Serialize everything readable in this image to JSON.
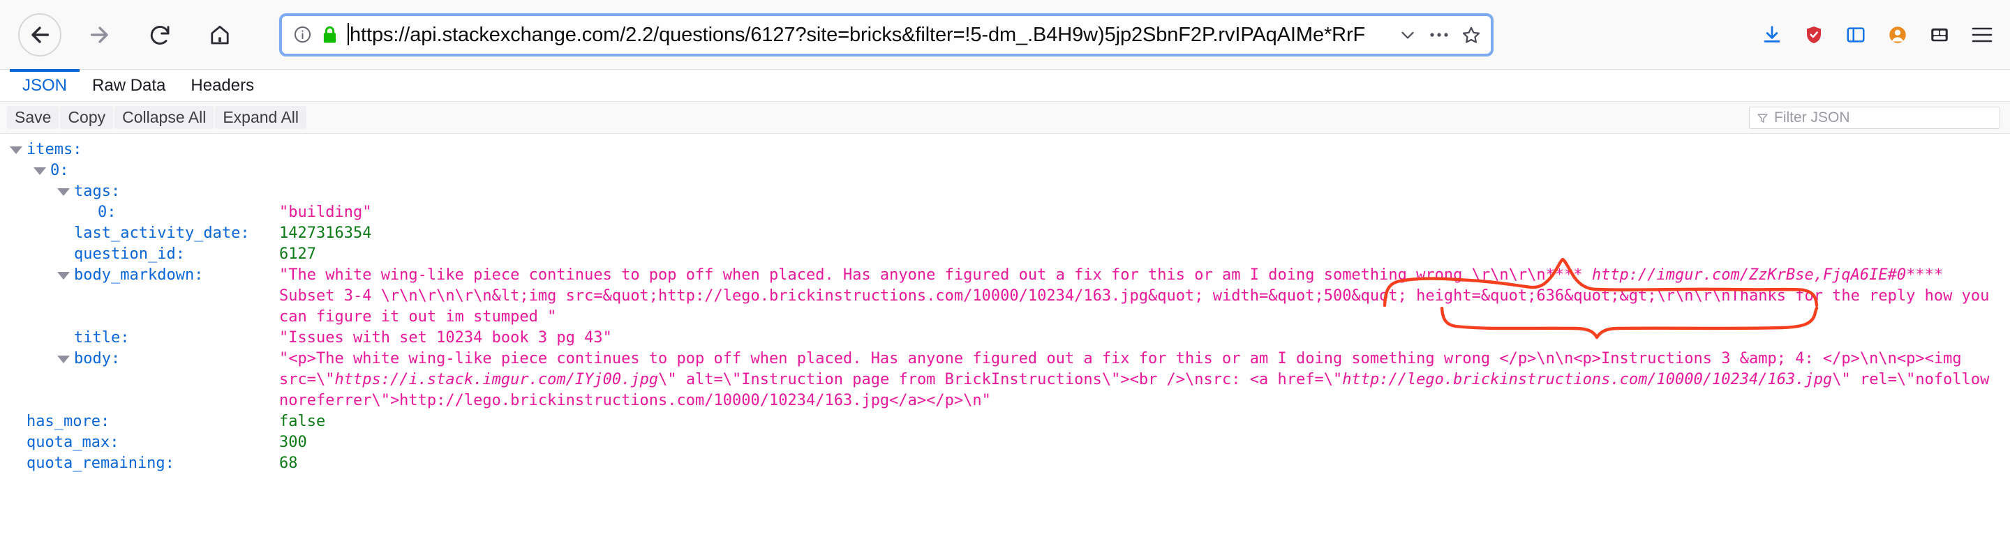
{
  "browser": {
    "back_label": "Back",
    "forward_label": "Forward",
    "reload_label": "Reload",
    "home_label": "Home",
    "url": "https://api.stackexchange.com/2.2/questions/6127?site=bricks&filter=!5-dm_.B4H9w)5jp2SbnF2P.rvIPAqAIMe*RrF",
    "identity_icon": "info-icon",
    "lock_icon": "padlock-icon",
    "dropdown_icon": "chevron-down-icon",
    "more_icon": "ellipsis-icon",
    "bookmark_icon": "star-icon",
    "right_icons": [
      "downloads-icon",
      "shield-icon",
      "sidebar-icon",
      "container-icon",
      "screenshot-icon",
      "menu-icon"
    ]
  },
  "viewer": {
    "tabs": [
      {
        "label": "JSON",
        "active": true
      },
      {
        "label": "Raw Data",
        "active": false
      },
      {
        "label": "Headers",
        "active": false
      }
    ],
    "toolbar": {
      "save_label": "Save",
      "copy_label": "Copy",
      "collapse_label": "Collapse All",
      "expand_label": "Expand All",
      "filter_placeholder": "Filter JSON",
      "filter_value": "",
      "filter_icon": "funnel-icon"
    }
  },
  "json": {
    "items_key": "items:",
    "item0_key": "0:",
    "tags_key": "tags:",
    "tag0_key": "0:",
    "tag0_value": "\"building\"",
    "last_activity_date_key": "last_activity_date:",
    "last_activity_date_value": "1427316354",
    "question_id_key": "question_id:",
    "question_id_value": "6127",
    "body_markdown_key": "body_markdown:",
    "body_markdown_p1": "\"The white wing-like piece continues to pop off when placed. Has anyone figured out a fix for this or am I doing something wrong \\r\\n\\r\\n**** ",
    "body_markdown_url": "http://imgur.com/ZzKrBse,FjqA6IE#0",
    "body_markdown_p2": "**** Subset 3-4 \\r\\n\\r\\n\\r\\n&lt;img src=&quot;http://lego.brickinstructions.com/10000/10234/163.jpg&quot; width=&quot;500&quot; height=&quot;636&quot;&gt;\\r\\n\\r\\nThanks for the reply how you can figure it out im stumped \"",
    "title_key": "title:",
    "title_value": "\"Issues with set 10234 book 3 pg 43\"",
    "body_key": "body:",
    "body_p1": "\"<p>The white wing-like piece continues to pop off when placed. Has anyone figured out a fix for this or am I doing something wrong </p>\\n\\n<p>Instructions 3 &amp; 4: </p>\\n\\n<p><img src=\\\"",
    "body_url1": "https://i.stack.imgur.com/IYj00.jpg",
    "body_p2": "\\\" alt=\\\"Instruction page from BrickInstructions\\\"><br />\\nsrc: <a href=\\\"",
    "body_url2": "http://lego.brickinstructions.com/10000/10234/163.jpg",
    "body_p3": "\\\" rel=\\\"nofollow noreferrer\\\">http://lego.brickinstructions.com/10000/10234/163.jpg</a></p>\\n\"",
    "has_more_key": "has_more:",
    "has_more_value": "false",
    "quota_max_key": "quota_max:",
    "quota_max_value": "300",
    "quota_remaining_key": "quota_remaining:",
    "quota_remaining_value": "68"
  },
  "annotation": {
    "color": "#f4401f",
    "shape": "hand-drawn-curly-brace"
  },
  "colors": {
    "key_blue": "#0a66d6",
    "string_pink": "#e6199b",
    "number_green": "#0e7a17",
    "url_focus_blue": "#7cabef",
    "lock_green": "#12bc00"
  }
}
